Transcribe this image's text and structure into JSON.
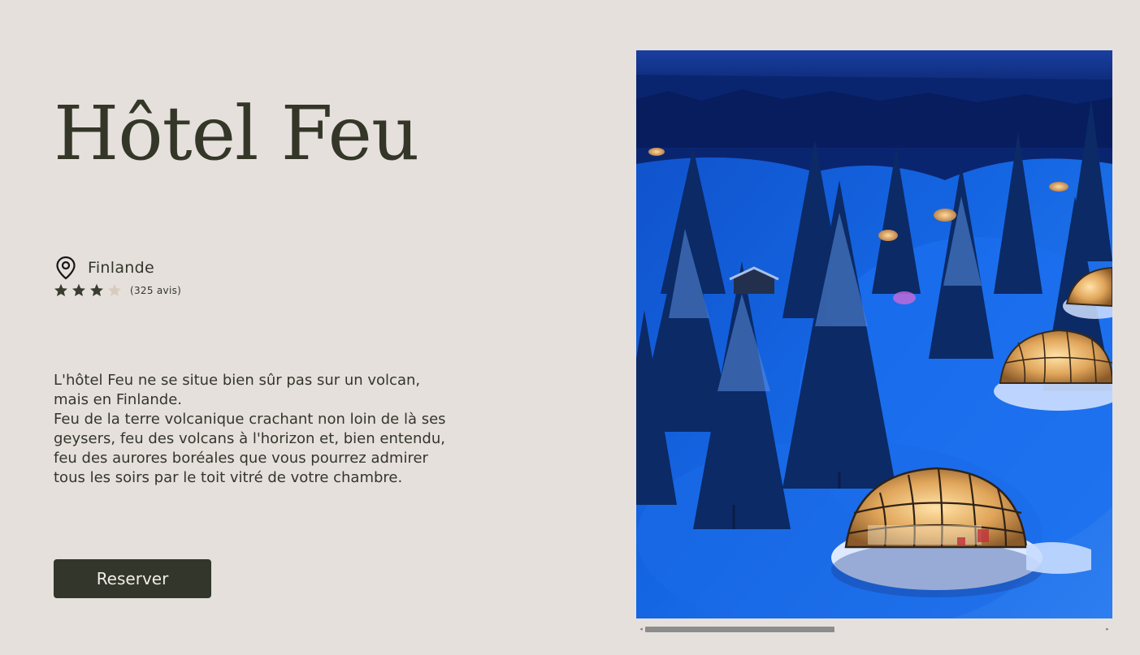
{
  "hotel": {
    "name": "Hôtel Feu",
    "location": "Finlande",
    "rating": {
      "value": 3,
      "max": 4,
      "reviews_label": "(325 avis)"
    },
    "description": "L'hôtel Feu ne se situe bien sûr pas sur un volcan,\nmais en Finlande.\nFeu de la terre volcanique crachant non loin de là ses\ngeysers, feu des volcans à l'horizon et, bien entendu,\nfeu des aurores boréales que vous pourrez admirer\ntous les soirs par le toit vitré de votre chambre.",
    "cta_label": "Reserver"
  },
  "gallery": {
    "scroll_position": 0.0
  },
  "icons": {
    "location": "map-pin-icon",
    "star_filled": "star-filled-icon",
    "star_empty": "star-empty-icon",
    "scroll_left": "chevron-left-icon",
    "scroll_right": "chevron-right-icon"
  },
  "colors": {
    "background": "#e6e0dd",
    "text": "#33362a",
    "button_bg": "#33362a",
    "button_text": "#f1ede9",
    "star_filled": "#3a3c30",
    "star_empty": "#d8cbbd"
  }
}
